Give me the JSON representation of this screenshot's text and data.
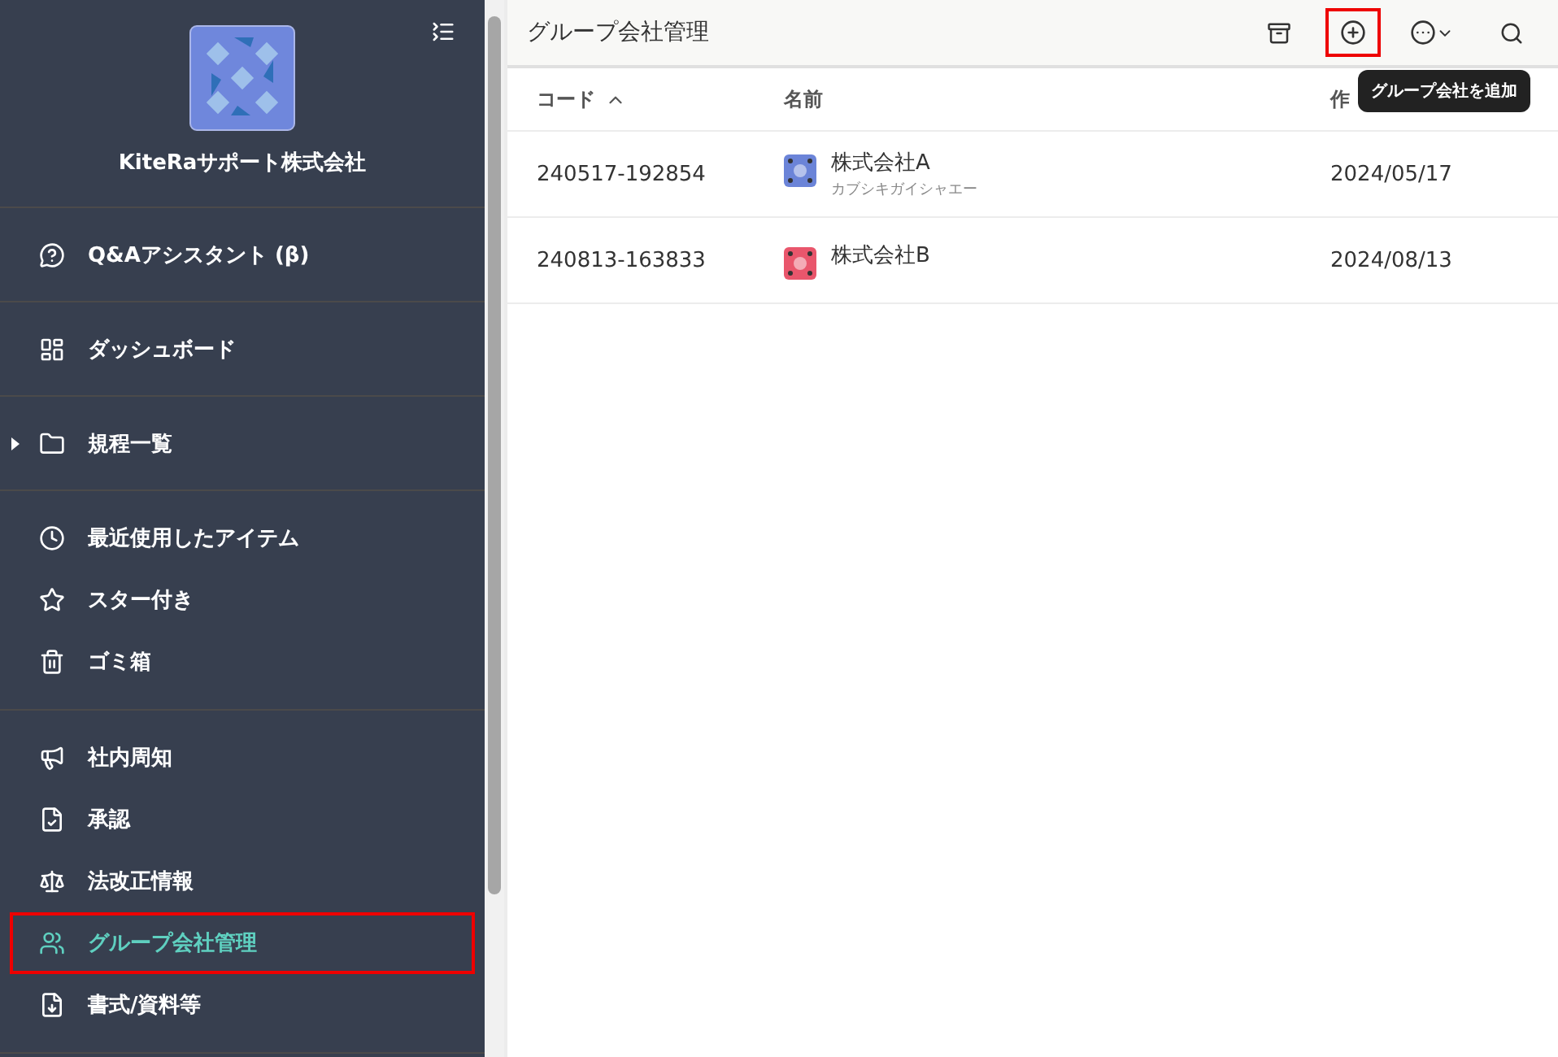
{
  "sidebar": {
    "company_name": "KiteRaサポート株式会社",
    "sections": [
      {
        "items": [
          {
            "label": "Q&Aアシスタント (β)",
            "selected": false,
            "highlighted": false
          }
        ]
      },
      {
        "items": [
          {
            "label": "ダッシュボード",
            "selected": false,
            "highlighted": false
          }
        ]
      },
      {
        "items": [
          {
            "label": "規程一覧",
            "selected": false,
            "highlighted": false,
            "expanded": false
          }
        ]
      },
      {
        "items": [
          {
            "label": "最近使用したアイテム",
            "selected": false,
            "highlighted": false
          },
          {
            "label": "スター付き",
            "selected": false,
            "highlighted": false
          },
          {
            "label": "ゴミ箱",
            "selected": false,
            "highlighted": false
          }
        ]
      },
      {
        "items": [
          {
            "label": "社内周知",
            "selected": false,
            "highlighted": false
          },
          {
            "label": "承認",
            "selected": false,
            "highlighted": false
          },
          {
            "label": "法改正情報",
            "selected": false,
            "highlighted": false
          },
          {
            "label": "グループ会社管理",
            "selected": true,
            "highlighted": true
          },
          {
            "label": "書式/資料等",
            "selected": false,
            "highlighted": false
          }
        ]
      }
    ]
  },
  "page": {
    "title": "グループ会社管理",
    "add_button": {
      "highlighted": true,
      "tooltip": "グループ会社を追加"
    }
  },
  "table": {
    "columns": [
      {
        "label": "コード",
        "sorted": true
      },
      {
        "label": "名前"
      },
      {
        "label": "作"
      }
    ],
    "rows": [
      {
        "code": "240517-192854",
        "name": "株式会社A",
        "reading": "カブシキガイシャエー",
        "color": "#6b84d8",
        "created": "2024/05/17"
      },
      {
        "code": "240813-163833",
        "name": "株式会社B",
        "color": "#e9566c",
        "created": "2024/08/13"
      }
    ]
  }
}
